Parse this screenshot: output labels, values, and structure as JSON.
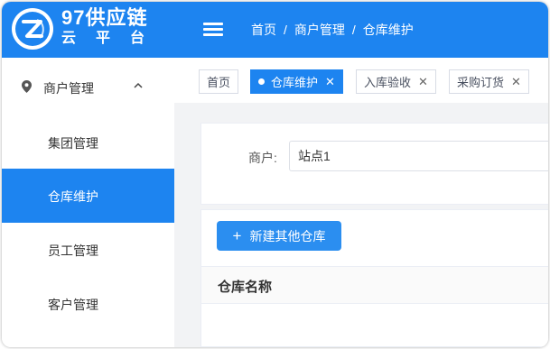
{
  "brand": {
    "title": "97供应链",
    "subtitle": "云平台"
  },
  "header": {
    "breadcrumbs": [
      {
        "label": "首页"
      },
      {
        "label": "商户管理"
      },
      {
        "label": "仓库维护"
      }
    ],
    "separator": "/"
  },
  "sidebar": {
    "group": {
      "label": "商户管理",
      "icon": "location-pin-icon",
      "expanded": true
    },
    "items": [
      {
        "label": "集团管理",
        "active": false
      },
      {
        "label": "仓库维护",
        "active": true
      },
      {
        "label": "员工管理",
        "active": false
      },
      {
        "label": "客户管理",
        "active": false
      }
    ]
  },
  "tabs": [
    {
      "label": "首页",
      "active": false,
      "closable": false
    },
    {
      "label": "仓库维护",
      "active": true,
      "closable": true
    },
    {
      "label": "入库验收",
      "active": false,
      "closable": true
    },
    {
      "label": "采购订货",
      "active": false,
      "closable": true
    }
  ],
  "filter": {
    "merchant_label": "商户:",
    "merchant_value": "站点1"
  },
  "toolbar": {
    "add_label": "新建其他仓库",
    "add_icon": "+"
  },
  "table": {
    "columns": [
      "仓库名称"
    ]
  },
  "close_glyph": "✕",
  "colors": {
    "primary": "#1d84f0",
    "button": "#2b8ef0"
  }
}
